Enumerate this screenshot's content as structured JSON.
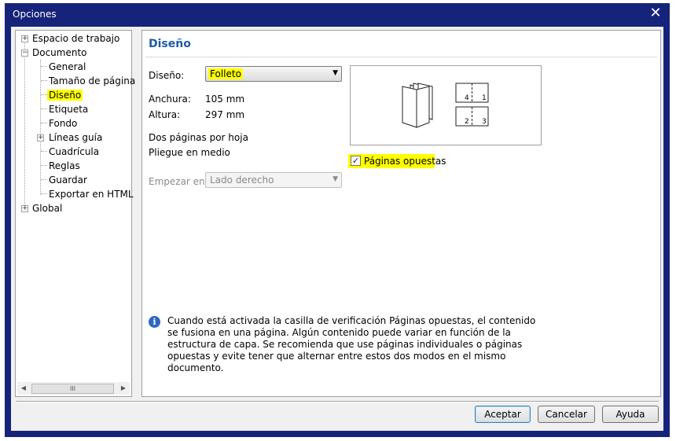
{
  "window": {
    "title": "Opciones"
  },
  "tree": {
    "items": [
      {
        "label": "Espacio de trabajo",
        "expander": "+"
      },
      {
        "label": "Documento",
        "expander": "−"
      },
      {
        "label": "General"
      },
      {
        "label": "Tamaño de página"
      },
      {
        "label": "Diseño",
        "selected": true
      },
      {
        "label": "Etiqueta"
      },
      {
        "label": "Fondo"
      },
      {
        "label": "Líneas guía",
        "expander": "+"
      },
      {
        "label": "Cuadrícula"
      },
      {
        "label": "Reglas"
      },
      {
        "label": "Guardar"
      },
      {
        "label": "Exportar en HTML"
      },
      {
        "label": "Global",
        "expander": "+"
      }
    ],
    "scroll_thumb": "III"
  },
  "panel": {
    "title": "Diseño",
    "layout_label": "Diseño:",
    "layout_value": "Folleto",
    "width_label": "Anchura:",
    "width_value": "105 mm",
    "height_label": "Altura:",
    "height_value": "297 mm",
    "line1": "Dos páginas por hoja",
    "line2": "Pliegue en medio",
    "start_label": "Empezar en:",
    "start_value": "Lado derecho",
    "facing_pages_label": "Páginas opuestas",
    "facing_pages_checked": true,
    "preview": {
      "p4": "4",
      "p1": "1",
      "p2": "2",
      "p3": "3"
    },
    "info": "Cuando está activada la casilla de verificación Páginas opuestas, el contenido se fusiona en una página. Algún contenido puede variar en función de la estructura de capa. Se recomienda que use páginas individuales o páginas opuestas y evite tener que alternar entre estos dos modos en el mismo documento."
  },
  "buttons": {
    "ok": "Aceptar",
    "cancel": "Cancelar",
    "help": "Ayuda"
  },
  "colors": {
    "titlebar": "#16237a",
    "heading": "#1e5ba8",
    "highlight": "#ffff00"
  }
}
